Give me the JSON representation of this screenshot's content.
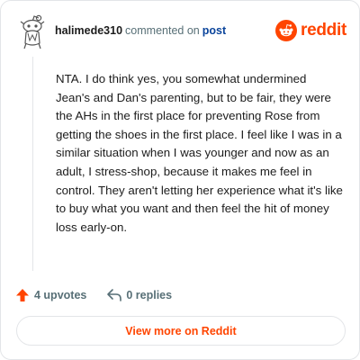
{
  "header": {
    "username": "halimede310",
    "action_text": "commented on",
    "post_link": "post",
    "avatar_icon": "snoo-avatar-icon",
    "brand_icon": "reddit-logo-icon",
    "brand_name": "reddit"
  },
  "comment": {
    "body": "NTA. I do think yes, you somewhat undermined Jean's and Dan's parenting, but to be fair, they were the AHs in the first place for preventing Rose from getting the shoes in the first place. I feel like I was in a similar situation when I was younger and now as an adult, I stress-shop, because it makes me feel in control. They aren't letting her experience what it's like to buy what you want and then feel the hit of money loss early-on."
  },
  "actions": {
    "upvote_icon": "upvote-arrow-icon",
    "upvotes": "4 upvotes",
    "reply_icon": "reply-arrow-icon",
    "replies": "0 replies"
  },
  "footer": {
    "view_label": "View more on Reddit"
  },
  "colors": {
    "brand": "#ff4500",
    "link": "#0a449b",
    "muted": "#576f76",
    "border": "#e3e5e8"
  }
}
